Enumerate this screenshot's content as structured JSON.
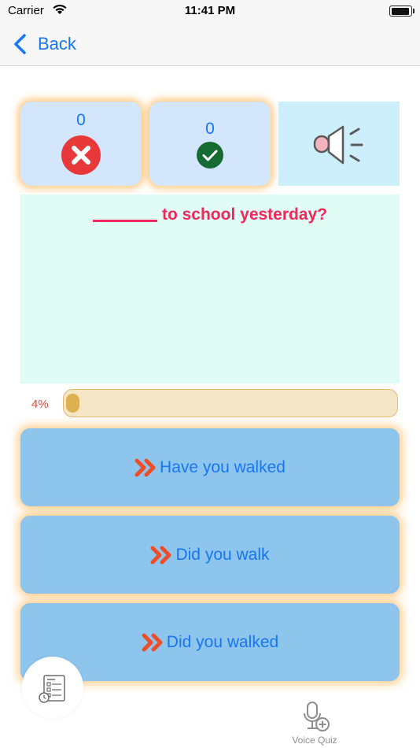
{
  "status_bar": {
    "carrier": "Carrier",
    "time": "11:41 PM"
  },
  "nav": {
    "back_label": "Back"
  },
  "score": {
    "wrong_count": "0",
    "right_count": "0"
  },
  "question": {
    "text": "to school yesterday?"
  },
  "progress": {
    "label": "4%",
    "value_percent": 4
  },
  "answers": [
    {
      "label": "Have you walked"
    },
    {
      "label": "Did you walk"
    },
    {
      "label": "Did you walked"
    }
  ],
  "tabs": {
    "voice_quiz_label": "Voice Quiz"
  },
  "icons": {
    "wrong": "x-circle-icon",
    "right": "check-circle-icon",
    "speaker": "speaker-icon",
    "answer": "double-chevron-right-icon",
    "quiz": "quiz-sheet-icon",
    "voice": "microphone-plus-icon"
  },
  "colors": {
    "accent": "#1676f3",
    "question_text": "#f0285b",
    "answer_bg": "#8ec5ed",
    "glow": "#ffb046",
    "wrong": "#e8383a",
    "right": "#156b32"
  }
}
